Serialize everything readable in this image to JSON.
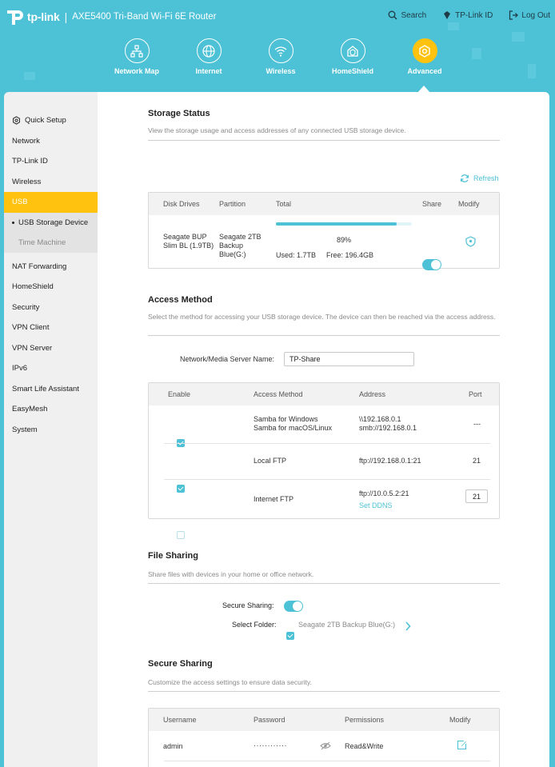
{
  "header": {
    "brand": "tp-link",
    "model": "AXE5400 Tri-Band Wi-Fi 6E Router",
    "links": [
      {
        "label": "Search",
        "icon": "search-icon"
      },
      {
        "label": "TP-Link ID",
        "icon": "tplink-id-icon"
      },
      {
        "label": "Log Out",
        "icon": "logout-icon"
      }
    ],
    "nav": [
      {
        "label": "Network Map",
        "icon": "network-map-icon"
      },
      {
        "label": "Internet",
        "icon": "globe-icon"
      },
      {
        "label": "Wireless",
        "icon": "wifi-icon"
      },
      {
        "label": "HomeShield",
        "icon": "homeshield-icon"
      },
      {
        "label": "Advanced",
        "icon": "gear-icon",
        "active": true
      }
    ]
  },
  "sidebar": {
    "items": [
      {
        "label": "Quick Setup"
      },
      {
        "label": "Network"
      },
      {
        "label": "TP-Link ID"
      },
      {
        "label": "Wireless"
      },
      {
        "label": "USB",
        "active": true
      },
      {
        "label": "NAT Forwarding"
      },
      {
        "label": "HomeShield"
      },
      {
        "label": "Security"
      },
      {
        "label": "VPN Client"
      },
      {
        "label": "VPN Server"
      },
      {
        "label": "IPv6"
      },
      {
        "label": "Smart Life Assistant"
      },
      {
        "label": "EasyMesh"
      },
      {
        "label": "System"
      }
    ],
    "usb_sub": [
      "USB Storage Device",
      "Time Machine"
    ]
  },
  "storage": {
    "title": "Storage Status",
    "desc": "View the storage usage and access addresses of any connected USB storage device.",
    "refresh": "Refresh",
    "headers": [
      "Disk Drives",
      "Partition",
      "Total",
      "Share",
      "Modify"
    ],
    "drive": "Seagate    BUP Slim BL (1.9TB)",
    "partition": "Seagate 2TB Backup Blue(G:)",
    "percent": "89%",
    "used": "Used: 1.7TB",
    "free": "Free: 196.4GB",
    "usage_fraction": 0.89
  },
  "access": {
    "title": "Access Method",
    "desc": "Select the method for accessing your USB storage device. The device can then be reached via the access address.",
    "server_label": "Network/Media Server Name:",
    "server_value": "TP-Share",
    "headers": [
      "Enable",
      "Access Method",
      "Address",
      "Port"
    ],
    "rows": [
      {
        "method1": "Samba for Windows",
        "method2": "Samba for macOS/Linux",
        "addr1": "\\\\192.168.0.1",
        "addr2": "smb://192.168.0.1",
        "port": "---",
        "enabled": true
      },
      {
        "method1": "Local FTP",
        "addr1": "ftp://192.168.0.1:21",
        "port": "21",
        "enabled": true
      },
      {
        "method1": "Internet FTP",
        "addr1": "ftp://10.0.5.2:21",
        "link": "Set DDNS",
        "port": "21",
        "enabled": false
      }
    ]
  },
  "file_sharing": {
    "title": "File Sharing",
    "desc": "Share files with devices in your home or office network.",
    "secure_label": "Secure Sharing:",
    "folder_label": "Select Folder:",
    "folder_value": "Seagate 2TB Backup Blue(G:)"
  },
  "secure": {
    "title": "Secure Sharing",
    "desc": "Customize the access settings to ensure data security.",
    "headers": [
      "Username",
      "Password",
      "Permissions",
      "Modify"
    ],
    "user": "admin",
    "password": "············",
    "permission": "Read&Write"
  }
}
